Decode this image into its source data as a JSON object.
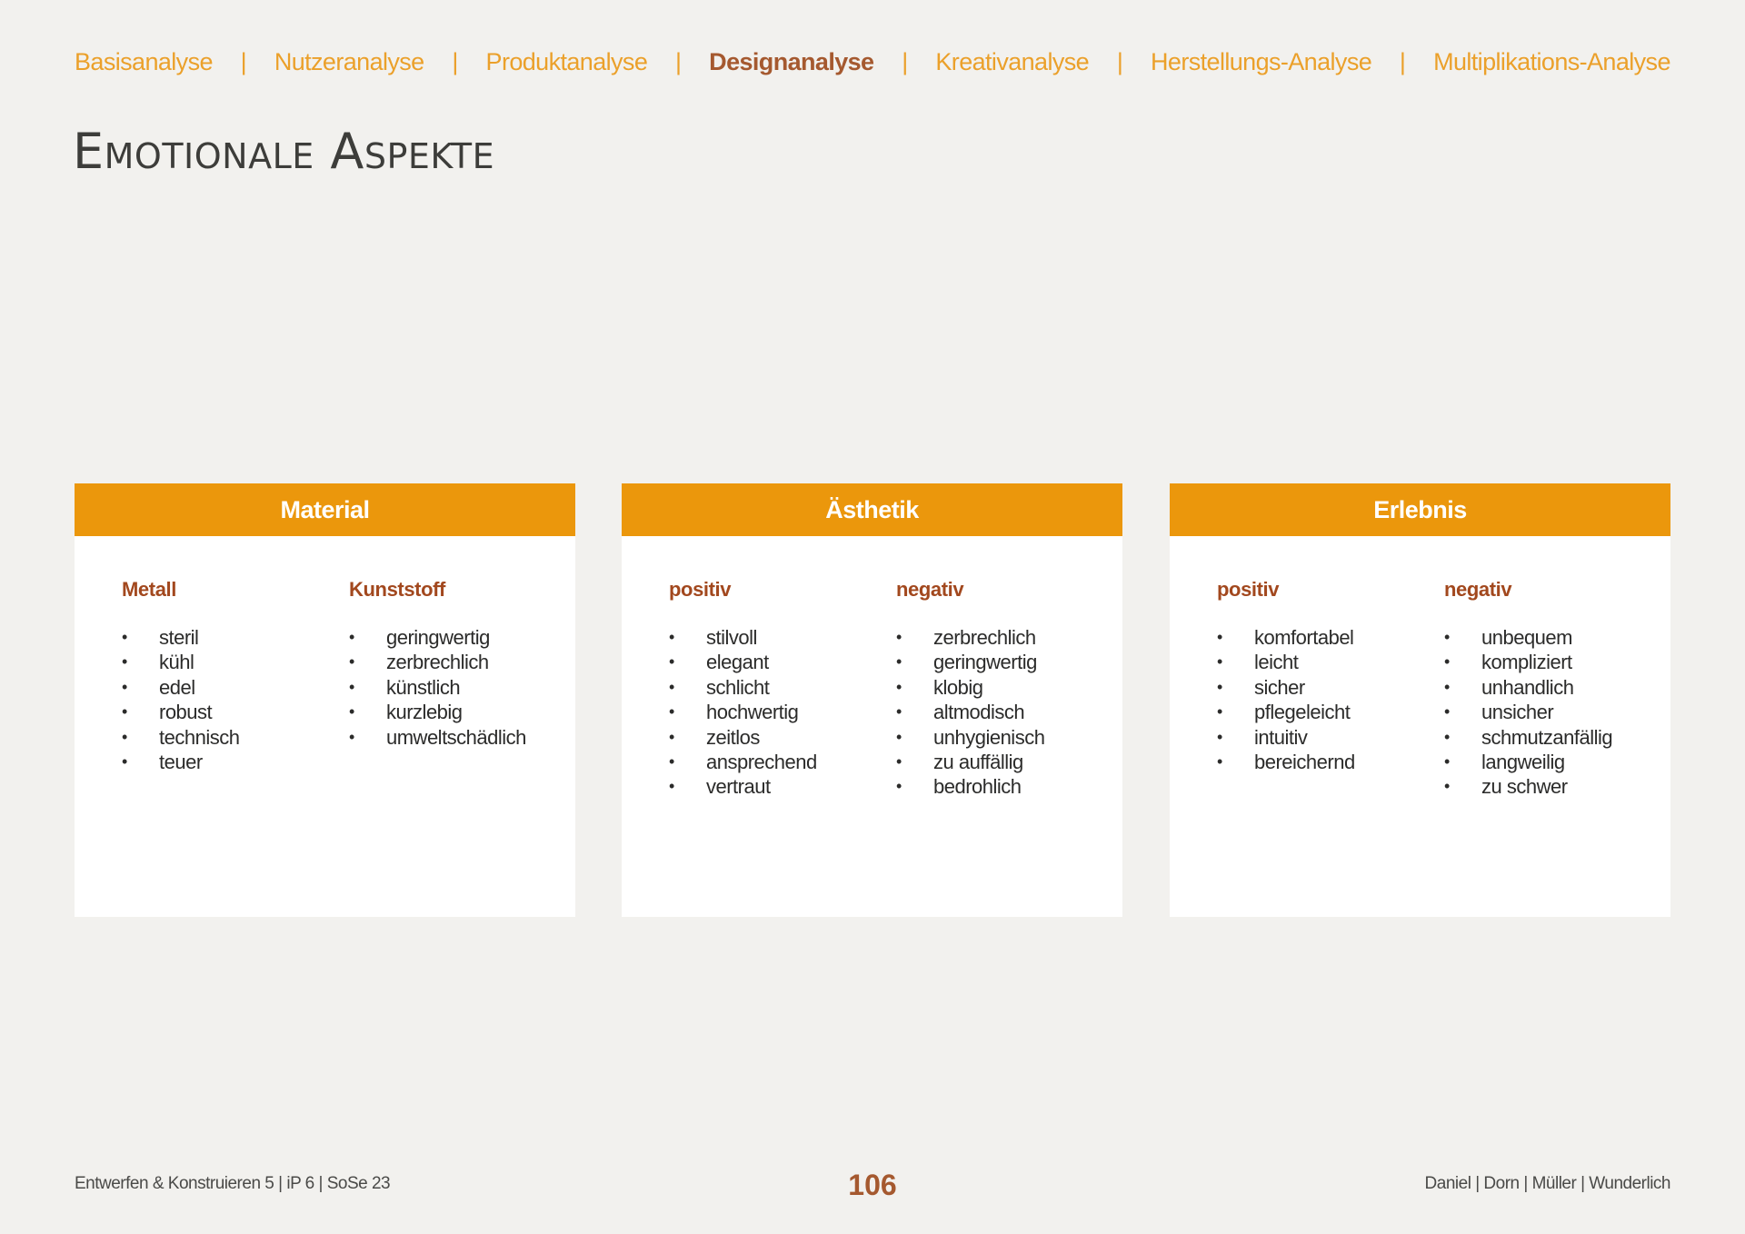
{
  "nav": {
    "items": [
      {
        "label": "Basisanalyse",
        "active": false
      },
      {
        "label": "Nutzeranalyse",
        "active": false
      },
      {
        "label": "Produktanalyse",
        "active": false
      },
      {
        "label": "Designanalyse",
        "active": true
      },
      {
        "label": "Kreativanalyse",
        "active": false
      },
      {
        "label": "Herstellungs-Analyse",
        "active": false
      },
      {
        "label": "Multiplikations-Analyse",
        "active": false
      }
    ],
    "separator": "|"
  },
  "title": "Emotionale Aspekte",
  "bullet": "•",
  "cards": [
    {
      "header": "Material",
      "columns": [
        {
          "heading": "Metall",
          "items": [
            "steril",
            "kühl",
            "edel",
            "robust",
            "technisch",
            "teuer"
          ]
        },
        {
          "heading": "Kunststoff",
          "items": [
            "geringwertig",
            "zerbrechlich",
            "künstlich",
            "kurzlebig",
            "umweltschädlich"
          ]
        }
      ]
    },
    {
      "header": "Ästhetik",
      "columns": [
        {
          "heading": "positiv",
          "items": [
            "stilvoll",
            "elegant",
            "schlicht",
            "hochwertig",
            "zeitlos",
            "ansprechend",
            "vertraut"
          ]
        },
        {
          "heading": "negativ",
          "items": [
            "zerbrechlich",
            "geringwertig",
            "klobig",
            "altmodisch",
            "unhygienisch",
            "zu auffällig",
            "bedrohlich"
          ]
        }
      ]
    },
    {
      "header": "Erlebnis",
      "columns": [
        {
          "heading": "positiv",
          "items": [
            "komfortabel",
            "leicht",
            "sicher",
            "pflegeleicht",
            "intuitiv",
            "bereichernd"
          ]
        },
        {
          "heading": "negativ",
          "items": [
            "unbequem",
            "kompliziert",
            "unhandlich",
            "unsicher",
            "schmutzanfällig",
            "langweilig",
            "zu schwer"
          ]
        }
      ]
    }
  ],
  "footer": {
    "left": "Entwerfen & Konstruieren 5 | iP 6 | SoSe 23",
    "page": "106",
    "right": "Daniel | Dorn | Müller | Wunderlich"
  },
  "colors": {
    "accent": "#eb970c",
    "nav": "#eba02a",
    "active": "#a5592f",
    "heading": "#a2481e",
    "background": "#f2f1ee"
  }
}
